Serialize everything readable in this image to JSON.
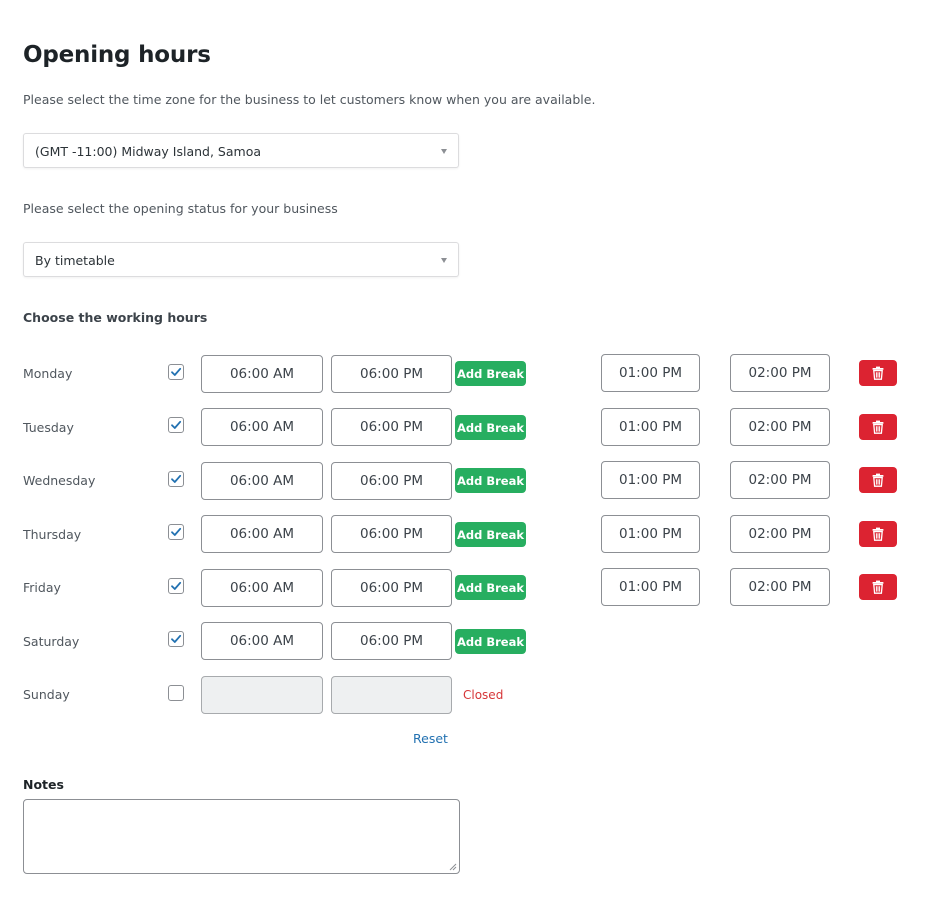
{
  "title": "Opening hours",
  "timezone": {
    "description": "Please select the time zone for the business to let customers know when you are available.",
    "selected": "(GMT -11:00) Midway Island, Samoa"
  },
  "status": {
    "description": "Please select the opening status for your business",
    "selected": "By timetable"
  },
  "working_hours_label": "Choose the working hours",
  "add_break_label": "Add Break",
  "closed_label": "Closed",
  "reset_label": "Reset",
  "notes_label": "Notes",
  "colors": {
    "add_break": "#27ae60",
    "delete": "#dc2331",
    "checkbox": "#2271b1",
    "closed": "#d63638",
    "link": "#2271b1"
  },
  "days": [
    {
      "name": "Monday",
      "enabled": true,
      "open": "06:00 AM",
      "close": "06:00 PM",
      "break_start": "01:00 PM",
      "break_end": "02:00 PM"
    },
    {
      "name": "Tuesday",
      "enabled": true,
      "open": "06:00 AM",
      "close": "06:00 PM",
      "break_start": "01:00 PM",
      "break_end": "02:00 PM"
    },
    {
      "name": "Wednesday",
      "enabled": true,
      "open": "06:00 AM",
      "close": "06:00 PM",
      "break_start": "01:00 PM",
      "break_end": "02:00 PM"
    },
    {
      "name": "Thursday",
      "enabled": true,
      "open": "06:00 AM",
      "close": "06:00 PM",
      "break_start": "01:00 PM",
      "break_end": "02:00 PM"
    },
    {
      "name": "Friday",
      "enabled": true,
      "open": "06:00 AM",
      "close": "06:00 PM",
      "break_start": "01:00 PM",
      "break_end": "02:00 PM"
    },
    {
      "name": "Saturday",
      "enabled": true,
      "open": "06:00 AM",
      "close": "06:00 PM"
    },
    {
      "name": "Sunday",
      "enabled": false,
      "open": "",
      "close": ""
    }
  ]
}
